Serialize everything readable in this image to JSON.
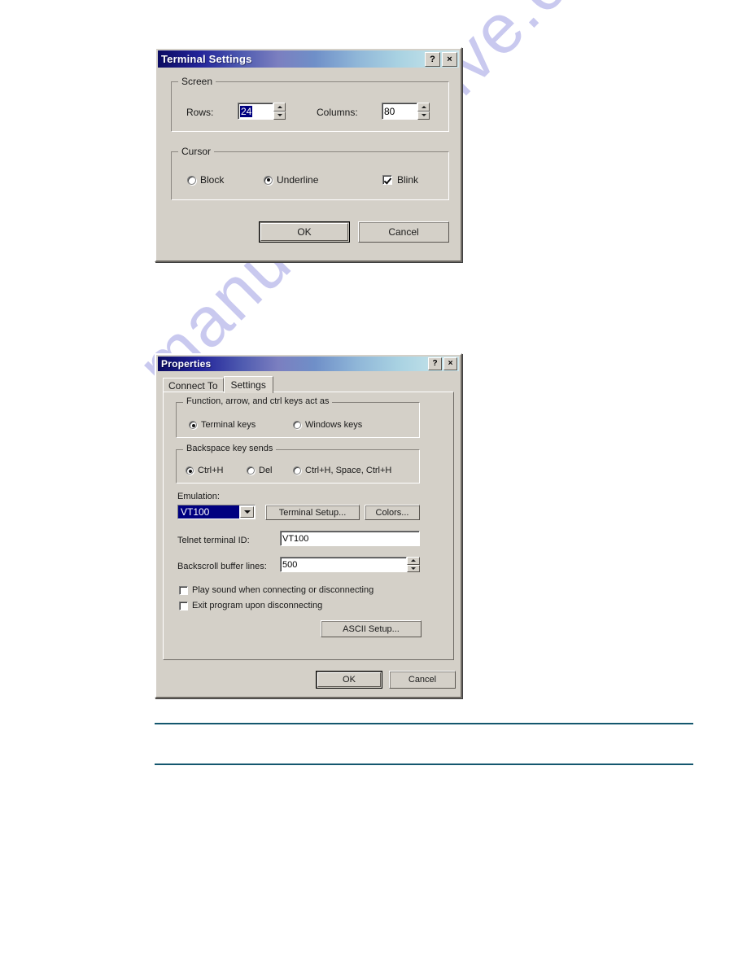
{
  "page": {
    "watermark": "manualsarchive.com",
    "background_color": "#ffffff",
    "rule_color": "#14576e"
  },
  "terminal_settings_dialog": {
    "title": "Terminal Settings",
    "titlebar_buttons": {
      "help": "?",
      "close": "×"
    },
    "screen_group": {
      "legend": "Screen",
      "rows_label": "Rows:",
      "rows_value": "24",
      "columns_label": "Columns:",
      "columns_value": "80"
    },
    "cursor_group": {
      "legend": "Cursor",
      "options": [
        {
          "label": "Block",
          "selected": false
        },
        {
          "label": "Underline",
          "selected": true
        }
      ],
      "blink_label": "Blink",
      "blink_checked": true
    },
    "buttons": {
      "ok": "OK",
      "cancel": "Cancel"
    }
  },
  "properties_dialog": {
    "title": "Properties",
    "titlebar_buttons": {
      "help": "?",
      "close": "×"
    },
    "tabs": [
      {
        "label": "Connect To",
        "active": false
      },
      {
        "label": "Settings",
        "active": true
      }
    ],
    "function_keys_group": {
      "legend": "Function, arrow, and ctrl keys act as",
      "options": [
        {
          "label": "Terminal keys",
          "selected": true
        },
        {
          "label": "Windows keys",
          "selected": false
        }
      ]
    },
    "backspace_group": {
      "legend": "Backspace key sends",
      "options": [
        {
          "label": "Ctrl+H",
          "selected": true
        },
        {
          "label": "Del",
          "selected": false
        },
        {
          "label": "Ctrl+H, Space, Ctrl+H",
          "selected": false
        }
      ]
    },
    "emulation": {
      "label": "Emulation:",
      "value": "VT100",
      "terminal_setup_button": "Terminal Setup...",
      "colors_button": "Colors..."
    },
    "telnet_terminal_id": {
      "label": "Telnet terminal ID:",
      "value": "VT100"
    },
    "backscroll_buffer_lines": {
      "label": "Backscroll buffer lines:",
      "value": "500"
    },
    "checkboxes": [
      {
        "label": "Play sound when connecting or disconnecting",
        "checked": false
      },
      {
        "label": "Exit program upon disconnecting",
        "checked": false
      }
    ],
    "ascii_setup_button": "ASCII Setup...",
    "buttons": {
      "ok": "OK",
      "cancel": "Cancel"
    }
  }
}
